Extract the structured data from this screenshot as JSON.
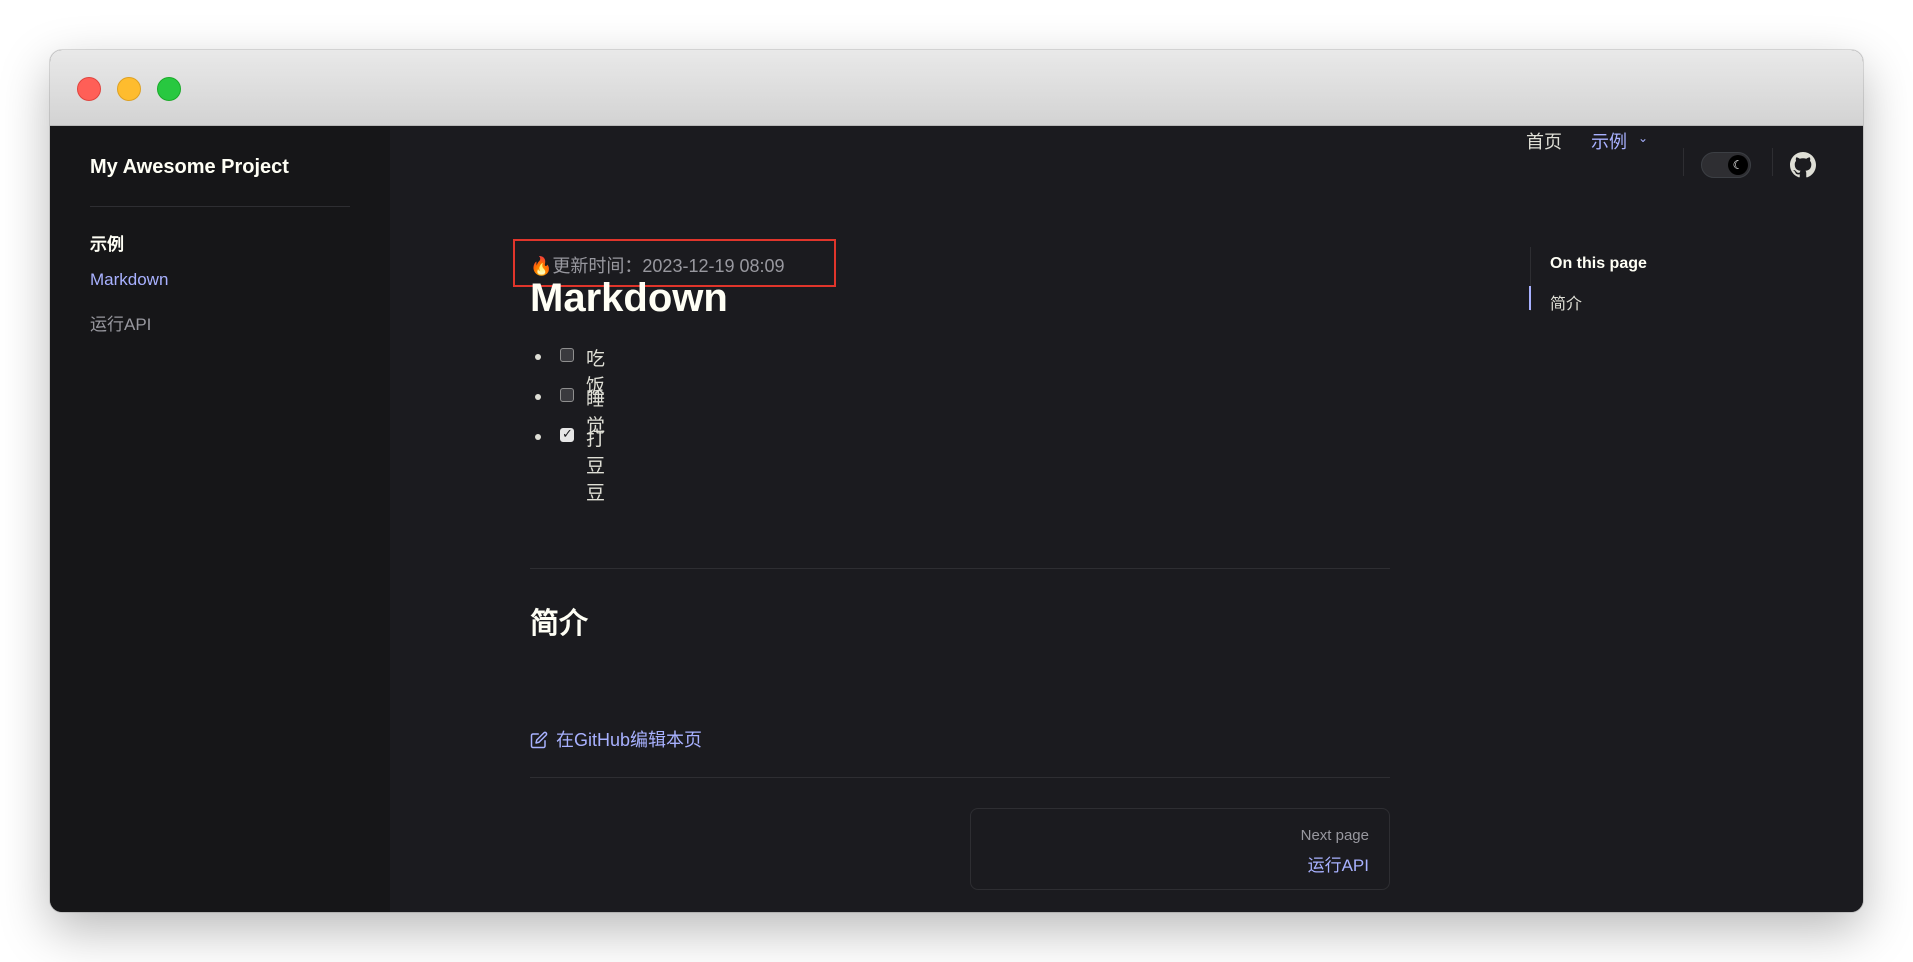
{
  "window": {
    "traffic_lights": [
      "close",
      "minimize",
      "maximize"
    ],
    "colors": {
      "close": "#ff5f57",
      "minimize": "#febc2e",
      "maximize": "#28c840"
    }
  },
  "sidebar": {
    "site_title": "My Awesome Project",
    "group_title": "示例",
    "items": [
      {
        "label": "Markdown",
        "active": true
      },
      {
        "label": "运行API",
        "active": false
      }
    ]
  },
  "topnav": {
    "home": "首页",
    "examples": "示例",
    "examples_icon": "chevron-down-icon",
    "theme_toggle_icon": "moon-icon",
    "github_icon": "github-icon"
  },
  "content": {
    "updated": "🔥更新时间：2023-12-19 08:09",
    "title": "Markdown",
    "todos": [
      {
        "text": "吃饭",
        "checked": false
      },
      {
        "text": "睡觉",
        "checked": false
      },
      {
        "text": "打豆豆",
        "checked": true
      }
    ],
    "section_heading": "简介",
    "edit_link": "在GitHub编辑本页",
    "pager": {
      "desc": "Next page",
      "title": "运行API"
    }
  },
  "outline": {
    "title": "On this page",
    "items": [
      "简介"
    ]
  },
  "theme": {
    "accent": "#a8b1ff",
    "background": "#1b1b1f",
    "sidebar_background": "#161618",
    "highlight_border": "#e0352b"
  }
}
